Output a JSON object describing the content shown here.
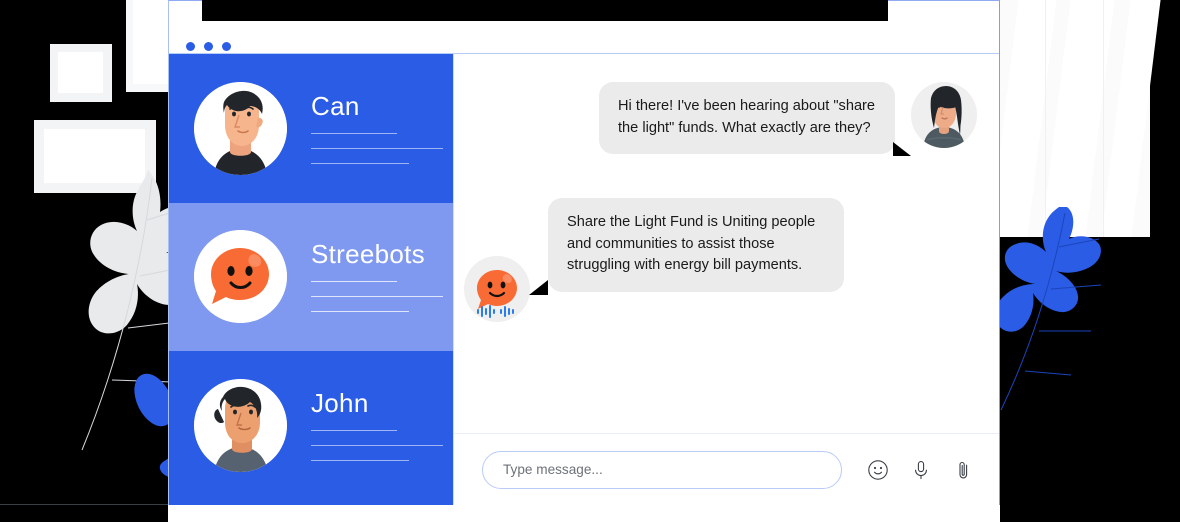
{
  "window": {
    "dots": [
      "dot-1",
      "dot-2",
      "dot-3"
    ],
    "accent_color": "#2b5ce6",
    "active_color": "#8099f0"
  },
  "sidebar": {
    "conversations": [
      {
        "name": "Can",
        "avatar": "man-dark-hair-avatar",
        "active": false
      },
      {
        "name": "Streebots",
        "avatar": "orange-chatbot-avatar",
        "active": true
      },
      {
        "name": "John",
        "avatar": "man-curly-hair-avatar",
        "active": false
      }
    ]
  },
  "chat": {
    "messages": [
      {
        "direction": "outgoing",
        "sender": "user",
        "avatar": "woman-long-hair-avatar",
        "text": "Hi there! I've been hearing about \"share the light\" funds. What exactly are they?"
      },
      {
        "direction": "incoming",
        "sender": "Streebots",
        "avatar": "orange-chatbot-avatar",
        "text": "Share the Light Fund is Uniting people and communities to assist those struggling with energy bill payments."
      }
    ]
  },
  "composer": {
    "placeholder": "Type message...",
    "value": "",
    "tools": [
      {
        "icon": "emoji-smiley-icon"
      },
      {
        "icon": "microphone-icon"
      },
      {
        "icon": "paperclip-icon"
      }
    ]
  }
}
